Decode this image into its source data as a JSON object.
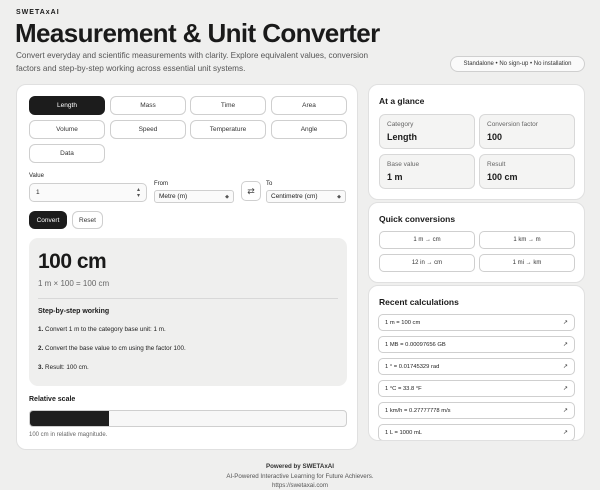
{
  "header": {
    "brand": "SWETAxAI",
    "title": "Measurement & Unit Converter",
    "description": "Convert everyday and scientific measurements with clarity. Explore equivalent values, conversion factors and step-by-step working across essential unit systems.",
    "badge": "Standalone • No sign-up • No installation"
  },
  "categories": [
    "Length",
    "Mass",
    "Time",
    "Area",
    "Volume",
    "Speed",
    "Temperature",
    "Angle",
    "Data"
  ],
  "active_category": "Length",
  "form": {
    "value_label": "Value",
    "value": "1",
    "from_label": "From",
    "from_value": "Metre (m)",
    "to_label": "To",
    "to_value": "Centimetre (cm)",
    "convert_label": "Convert",
    "reset_label": "Reset"
  },
  "result": {
    "big": "100 cm",
    "formula": "1 m × 100 = 100 cm",
    "steps_title": "Step-by-step working",
    "steps": [
      {
        "num": "1.",
        "text": "Convert 1 m to the category base unit: 1 m."
      },
      {
        "num": "2.",
        "text": "Convert the base value to cm using the factor 100."
      },
      {
        "num": "3.",
        "text": "Result: 100 cm."
      }
    ]
  },
  "relative": {
    "title": "Relative scale",
    "fill_fraction": 0.25,
    "note": "100 cm in relative magnitude."
  },
  "glance": {
    "title": "At a glance",
    "tiles": [
      {
        "label": "Category",
        "value": "Length"
      },
      {
        "label": "Conversion factor",
        "value": "100"
      },
      {
        "label": "Base value",
        "value": "1 m"
      },
      {
        "label": "Result",
        "value": "100 cm"
      }
    ]
  },
  "quick": {
    "title": "Quick conversions",
    "items": [
      "1 m → cm",
      "1 km → m",
      "12 in → cm",
      "1 mi → km"
    ]
  },
  "recent": {
    "title": "Recent calculations",
    "items": [
      "1 m = 100 cm",
      "1 MB = 0.00097656 GB",
      "1 ° = 0.01745329 rad",
      "1 °C = 33.8 °F",
      "1 km/h = 0.27777778 m/s",
      "1 L = 1000 mL"
    ]
  },
  "footer": {
    "powered": "Powered by SWETAxAI",
    "tagline": "AI-Powered Interactive Learning for Future Achievers.",
    "url": "https://swetaxai.com"
  }
}
